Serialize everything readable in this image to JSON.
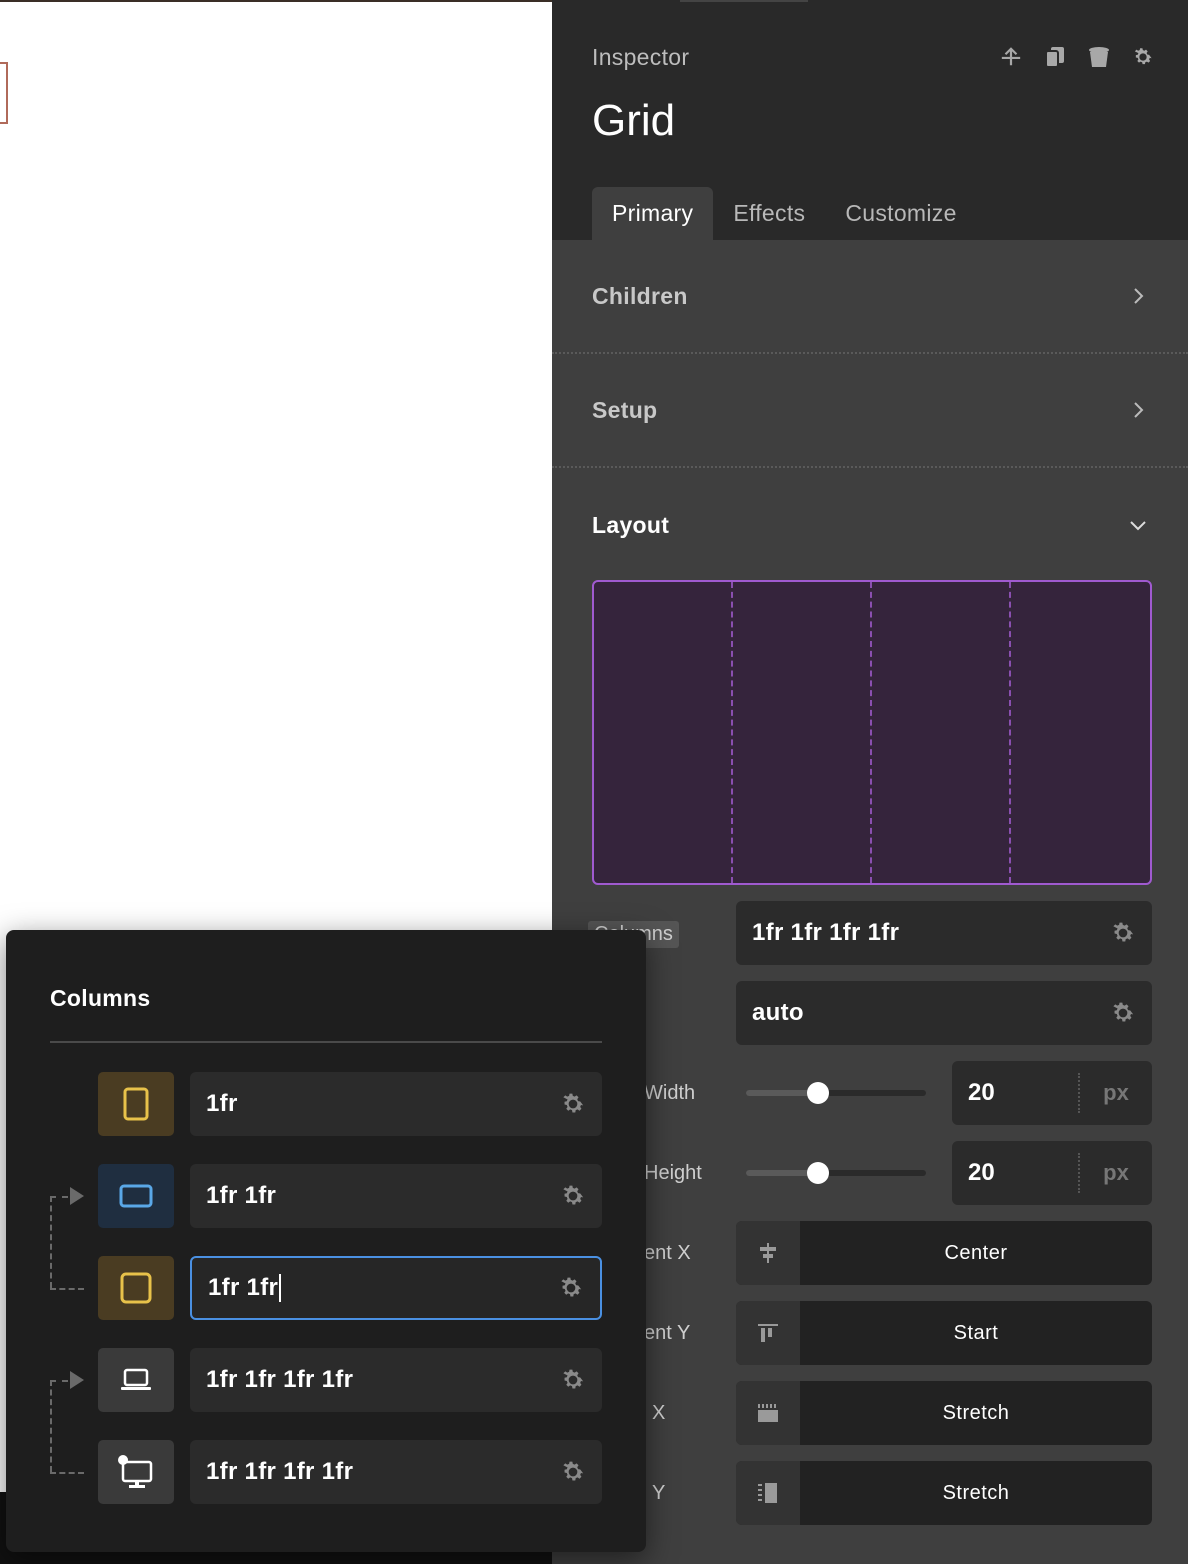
{
  "inspector": {
    "label": "Inspector",
    "title": "Grid",
    "header_icons": [
      "move-up-icon",
      "duplicate-icon",
      "delete-icon",
      "settings-icon"
    ],
    "tabs": [
      {
        "label": "Primary",
        "active": true
      },
      {
        "label": "Effects",
        "active": false
      },
      {
        "label": "Customize",
        "active": false
      }
    ],
    "sections": {
      "children": {
        "title": "Children",
        "state": "collapsed"
      },
      "setup": {
        "title": "Setup",
        "state": "collapsed"
      },
      "layout": {
        "title": "Layout",
        "state": "expanded"
      }
    },
    "grid_preview": {
      "columns": 4
    },
    "controls": {
      "columns_label": "Columns",
      "columns_value": "1fr 1fr 1fr 1fr",
      "rows_value": "auto",
      "gap_width_label": "Width",
      "gap_width_value": "20",
      "gap_width_unit": "px",
      "gap_width_slider": 0.4,
      "gap_height_label": "Height",
      "gap_height_value": "20",
      "gap_height_unit": "px",
      "gap_height_slider": 0.4,
      "justify_x_label": "ent X",
      "justify_x_value": "Center",
      "justify_y_label": "ent Y",
      "justify_y_value": "Start",
      "align_x_label": "X",
      "align_x_value": "Stretch",
      "align_y_label": "Y",
      "align_y_value": "Stretch"
    }
  },
  "popup": {
    "title": "Columns",
    "breakpoints": [
      {
        "icon": "mobile-portrait-icon",
        "value": "1fr",
        "color": "#e8c24a",
        "bg": "#4a3c22",
        "focused": false
      },
      {
        "icon": "mobile-landscape-icon",
        "value": "1fr 1fr",
        "color": "#5aa8e8",
        "bg": "#1f2e40",
        "focused": false
      },
      {
        "icon": "tablet-icon",
        "value": "1fr 1fr",
        "color": "#e8c24a",
        "bg": "#4a3c22",
        "focused": true
      },
      {
        "icon": "laptop-icon",
        "value": "1fr 1fr 1fr 1fr",
        "color": "#ffffff",
        "bg": "#3a3a3a",
        "focused": false
      },
      {
        "icon": "desktop-icon",
        "value": "1fr 1fr 1fr 1fr",
        "color": "#ffffff",
        "bg": "#3a3a3a",
        "focused": false
      }
    ]
  },
  "colors": {
    "accent_purple": "#a05ad0",
    "focus_blue": "#4a90e2",
    "panel_bg": "#3f3f3f",
    "header_bg": "#292929"
  }
}
